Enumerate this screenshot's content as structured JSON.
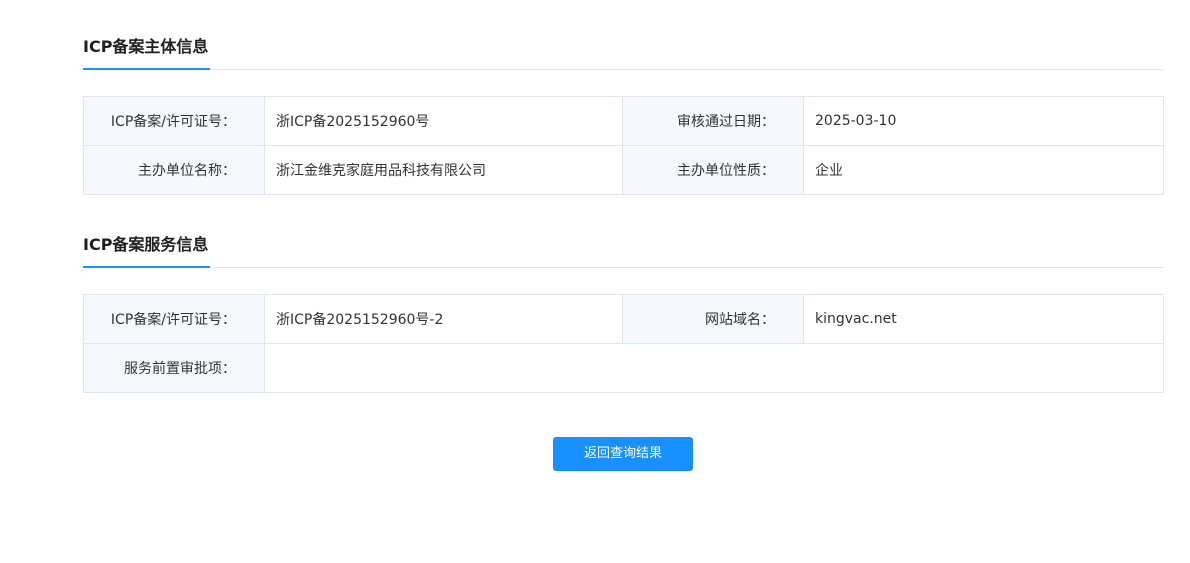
{
  "subject_section": {
    "title": "ICP备案主体信息",
    "rows": [
      {
        "label1": "ICP备案/许可证号：",
        "value1": "浙ICP备2025152960号",
        "label2": "审核通过日期：",
        "value2": "2025-03-10"
      },
      {
        "label1": "主办单位名称：",
        "value1": "浙江金维克家庭用品科技有限公司",
        "label2": "主办单位性质：",
        "value2": "企业"
      }
    ]
  },
  "service_section": {
    "title": "ICP备案服务信息",
    "rows": [
      {
        "label1": "ICP备案/许可证号：",
        "value1": "浙ICP备2025152960号-2",
        "label2": "网站域名：",
        "value2": "kingvac.net"
      },
      {
        "label1": "服务前置审批项：",
        "value1": ""
      }
    ]
  },
  "back_button": {
    "label": "返回查询结果"
  },
  "colors": {
    "accent": "#1890ff",
    "label_bg": "#f5f9fd",
    "border": "#dfe6ee"
  }
}
